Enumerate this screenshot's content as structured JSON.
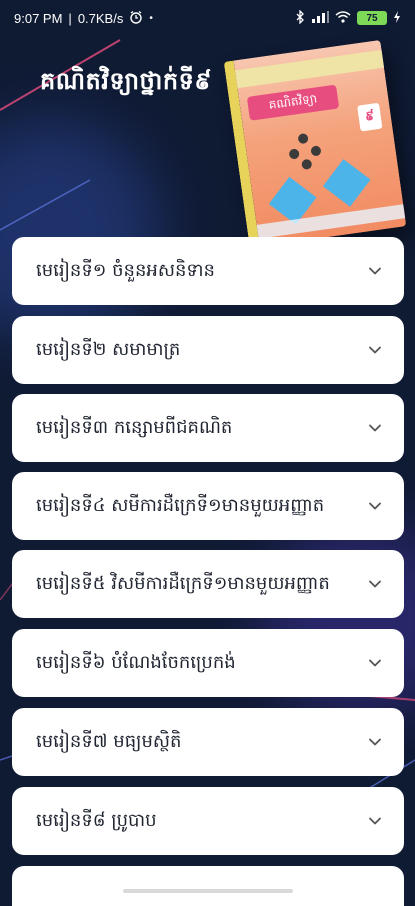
{
  "status_bar": {
    "time": "9:07 PM",
    "speed": "0.7KB/s",
    "battery": "75",
    "icons": [
      "alarm-icon",
      "bluetooth-icon",
      "signal-icon",
      "wifi-icon",
      "battery-icon",
      "charging-icon"
    ]
  },
  "header": {
    "title": "គណិតវិទ្យាថ្នាក់ទី៩",
    "book": {
      "cover_title": "គណិតវិទ្យា",
      "grade": "៩"
    }
  },
  "lessons": [
    {
      "label": "មេរៀនទី១ ចំនួនអសនិទាន"
    },
    {
      "label": "មេរៀនទី២ សមាមាត្រ"
    },
    {
      "label": "មេរៀនទី៣ កន្សោមពីជគណិត"
    },
    {
      "label": "មេរៀនទី៤ សមីការដឺក្រេទី១មានមួយអញ្ញាត"
    },
    {
      "label": "មេរៀនទី៥ វិសមីការដឺក្រេទី១មានមួយអញ្ញាត"
    },
    {
      "label": "មេរៀនទី៦ បំណែងចែកប្រេកង់"
    },
    {
      "label": "មេរៀនទី៧ មធ្យមស្ថិតិ"
    },
    {
      "label": "មេរៀនទី៨ ប្រូបាប"
    }
  ],
  "colors": {
    "background": "#0f1a33",
    "card": "#ffffff",
    "accent_pink": "#e84d7f",
    "accent_blue": "#3a7bd5"
  }
}
